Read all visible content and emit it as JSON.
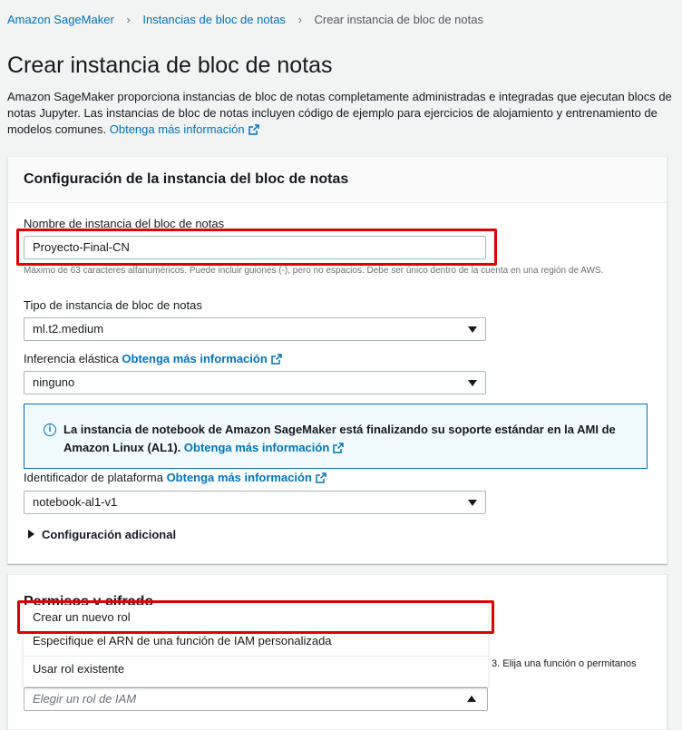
{
  "breadcrumb": {
    "items": [
      "Amazon SageMaker",
      "Instancias de bloc de notas"
    ],
    "current": "Crear instancia de bloc de notas"
  },
  "page": {
    "title": "Crear instancia de bloc de notas",
    "description": "Amazon SageMaker proporciona instancias de bloc de notas completamente administradas e integradas que ejecutan blocs de notas Jupyter. Las instancias de bloc de notas incluyen código de ejemplo para ejercicios de alojamiento y entrenamiento de modelos comunes.",
    "learn_more": "Obtenga más información"
  },
  "config_panel": {
    "title": "Configuración de la instancia del bloc de notas",
    "name_label": "Nombre de instancia del bloc de notas",
    "name_value": "Proyecto-Final-CN",
    "name_hint": "Máximo de 63 caracteres alfanuméricos. Puede incluir guiones (-), pero no espacios. Debe ser único dentro de la cuenta en una región de AWS.",
    "type_label": "Tipo de instancia de bloc de notas",
    "type_value": "ml.t2.medium",
    "inference_label": "Inferencia elástica",
    "inference_link": "Obtenga más información",
    "inference_value": "ninguno",
    "alert_text": "La instancia de notebook de Amazon SageMaker está finalizando su soporte estándar en la AMI de Amazon Linux (AL1).",
    "alert_link": "Obtenga más información",
    "platform_label": "Identificador de plataforma",
    "platform_link": "Obtenga más información",
    "platform_value": "notebook-al1-v1",
    "additional_config": "Configuración adicional"
  },
  "permissions_panel": {
    "title": "Permisos y cifrado",
    "desc_fragment": "3. Elija una función o permitanos",
    "role_placeholder": "Elegir un rol de IAM"
  },
  "role_dropdown": {
    "options": [
      "Crear un nuevo rol",
      "Especifique el ARN de una función de IAM personalizada",
      "Usar rol existente"
    ]
  },
  "colors": {
    "link": "#0073bb",
    "highlight": "#e00000",
    "info_bg": "#f1faff"
  }
}
